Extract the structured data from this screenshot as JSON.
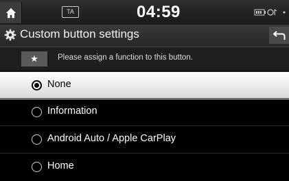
{
  "status": {
    "ta_label": "TA",
    "clock": "04:59"
  },
  "title": {
    "text": "Custom button settings"
  },
  "hint": {
    "text": "Please assign a function to this button."
  },
  "options": [
    {
      "label": "None",
      "selected": true
    },
    {
      "label": "Information",
      "selected": false
    },
    {
      "label": "Android Auto / Apple CarPlay",
      "selected": false
    },
    {
      "label": "Home",
      "selected": false
    }
  ],
  "colors": {
    "background": "#000000",
    "selected_row": "#ffffff",
    "hint_star_box": "#5a5a5a"
  }
}
